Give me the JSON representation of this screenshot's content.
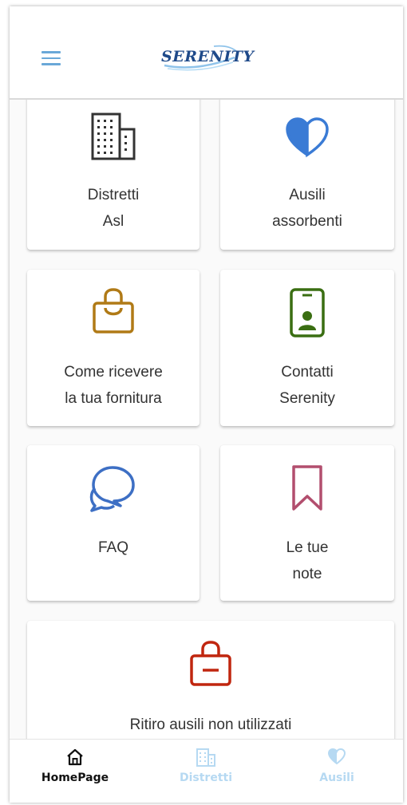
{
  "header": {
    "logo_text": "SERENITY"
  },
  "colors": {
    "accent": "#6aa8d8",
    "card_bg": "#ffffff",
    "text": "#333333",
    "nav_inactive": "#b6d9f2",
    "icon_districts": "#333333",
    "icon_absorbent": "#3a7bd5",
    "icon_supply": "#b07a16",
    "icon_contacts": "#3a6e12",
    "icon_faq": "#3d6fc4",
    "icon_notes": "#b24e6e",
    "icon_pickup": "#c0260f"
  },
  "cards": [
    {
      "icon": "building-icon",
      "line1": "Distretti",
      "line2": "Asl"
    },
    {
      "icon": "heart-icon",
      "line1": "Ausili",
      "line2": "assorbenti"
    },
    {
      "icon": "shopping-bag-icon",
      "line1": "Come ricevere",
      "line2": "la tua fornitura"
    },
    {
      "icon": "phone-contact-icon",
      "line1": "Contatti",
      "line2": "Serenity"
    },
    {
      "icon": "chat-bubbles-icon",
      "line1": "FAQ",
      "line2": ""
    },
    {
      "icon": "bookmark-icon",
      "line1": "Le tue",
      "line2": "note"
    },
    {
      "icon": "bag-minus-icon",
      "line1": "Ritiro ausili non utilizzati",
      "line2": ""
    }
  ],
  "bottom_nav": [
    {
      "icon": "home-icon",
      "label": "HomePage",
      "active": true
    },
    {
      "icon": "building-icon",
      "label": "Distretti",
      "active": false
    },
    {
      "icon": "heart-icon",
      "label": "Ausili",
      "active": false
    }
  ]
}
